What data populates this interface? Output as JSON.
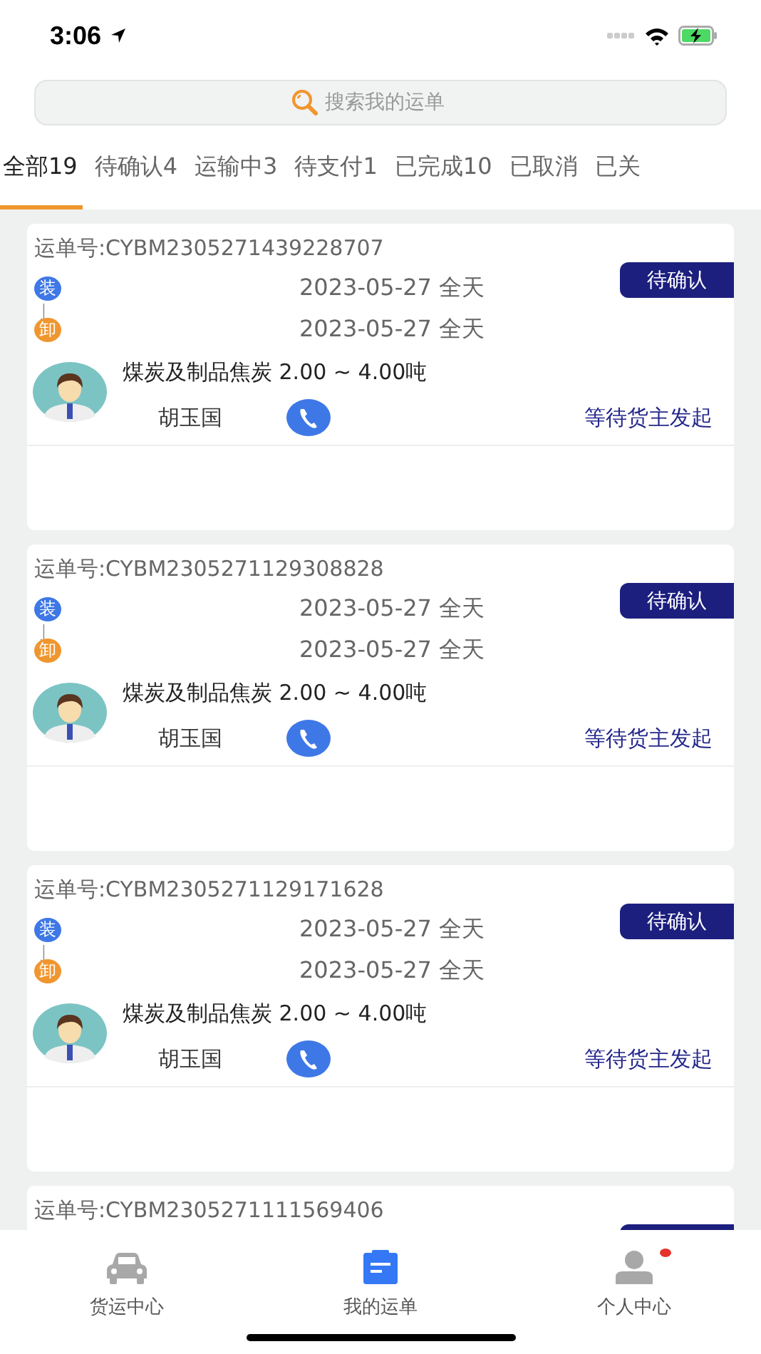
{
  "status_bar": {
    "time": "3:06"
  },
  "search": {
    "placeholder": "搜索我的运单"
  },
  "tabs": [
    {
      "label": "全部19",
      "selected": true
    },
    {
      "label": "待确认4",
      "selected": false
    },
    {
      "label": "运输中3",
      "selected": false
    },
    {
      "label": "待支付1",
      "selected": false
    },
    {
      "label": "已完成10",
      "selected": false
    },
    {
      "label": "已取消",
      "selected": false
    },
    {
      "label": "已关",
      "selected": false
    }
  ],
  "orders": [
    {
      "order_no": "运单号:CYBM2305271439228707",
      "status": "待确认",
      "load_badge": "装",
      "load_date": "2023-05-27 全天",
      "unload_badge": "卸",
      "unload_date": "2023-05-27 全天",
      "cargo": "煤炭及制品焦炭 2.00 ~ 4.00吨",
      "driver": "胡玉国",
      "progress": "等待货主发起"
    },
    {
      "order_no": "运单号:CYBM2305271129308828",
      "status": "待确认",
      "load_badge": "装",
      "load_date": "2023-05-27 全天",
      "unload_badge": "卸",
      "unload_date": "2023-05-27 全天",
      "cargo": "煤炭及制品焦炭 2.00 ~ 4.00吨",
      "driver": "胡玉国",
      "progress": "等待货主发起"
    },
    {
      "order_no": "运单号:CYBM2305271129171628",
      "status": "待确认",
      "load_badge": "装",
      "load_date": "2023-05-27 全天",
      "unload_badge": "卸",
      "unload_date": "2023-05-27 全天",
      "cargo": "煤炭及制品焦炭 2.00 ~ 4.00吨",
      "driver": "胡玉国",
      "progress": "等待货主发起"
    },
    {
      "order_no": "运单号:CYBM2305271111569406"
    }
  ],
  "tab_bar": [
    {
      "kind": "car",
      "label": "货运中心",
      "selected": false,
      "dot": false
    },
    {
      "kind": "order",
      "label": "我的运单",
      "selected": true,
      "dot": false
    },
    {
      "kind": "person",
      "label": "个人中心",
      "selected": false,
      "dot": true
    }
  ]
}
